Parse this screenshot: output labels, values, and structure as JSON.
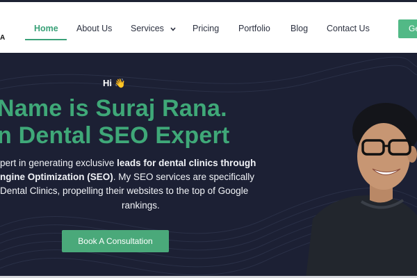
{
  "brand": {
    "logo_fragment": "A"
  },
  "nav": {
    "items": [
      {
        "label": "Home",
        "active": true
      },
      {
        "label": "About Us"
      },
      {
        "label": "Services",
        "has_dropdown": true
      },
      {
        "label": "Pricing"
      },
      {
        "label": "Portfolio"
      },
      {
        "label": "Blog"
      },
      {
        "label": "Contact Us"
      }
    ],
    "cta_label": "Ge"
  },
  "hero": {
    "greeting": "Hi 👋",
    "headline_line1": "Name is Suraj Rana.",
    "headline_line2": "n Dental SEO Expert",
    "desc_line1_prefix": "pert in generating exclusive ",
    "desc_line1_bold": "leads for dental clinics through",
    "desc_line2_bold": "ngine Optimization (SEO)",
    "desc_line2_rest": ". My SEO services are specifically",
    "desc_line3": " Dental Clinics, propelling their websites to the top of Google",
    "desc_line4": "rankings.",
    "button_label": "Book A Consultation"
  },
  "colors": {
    "accent": "#3fa878",
    "hero_bg": "#1c2034",
    "button": "#4aa97a"
  }
}
